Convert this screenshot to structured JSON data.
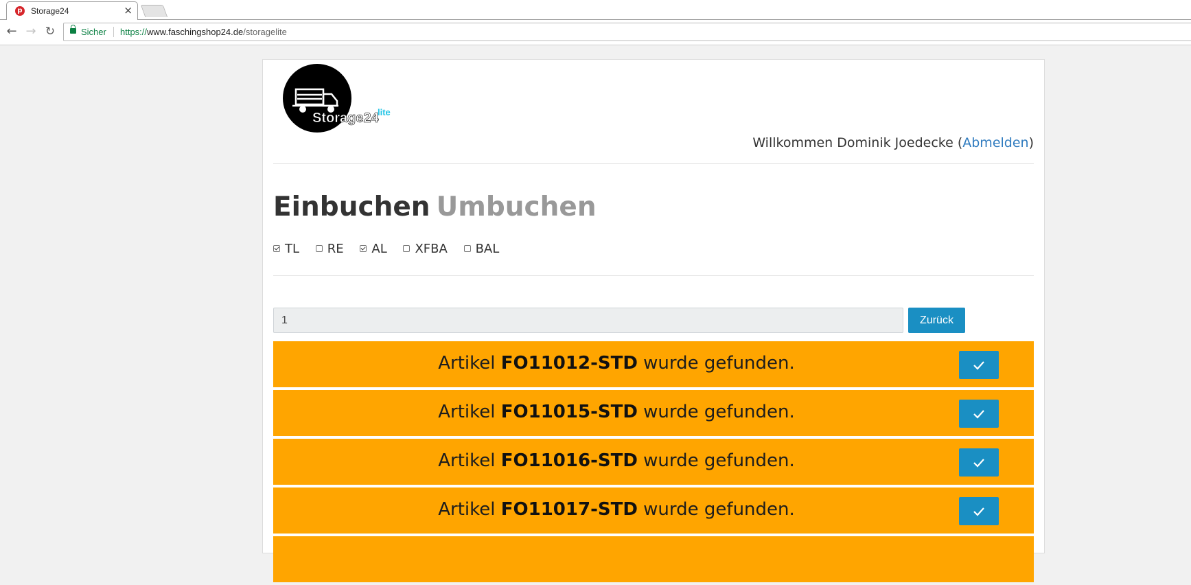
{
  "browser": {
    "tab_title": "Storage24",
    "tab_close": "×",
    "secure_label": "Sicher",
    "url_scheme": "https://",
    "url_host": "www.faschingshop24.de",
    "url_path": "/storagelite"
  },
  "header": {
    "logo_text": "Storage24",
    "logo_suffix": "lite",
    "welcome_prefix": "Willkommen Dominik Joedecke (",
    "logout_label": "Abmelden",
    "welcome_suffix": ")"
  },
  "modes": {
    "active": "Einbuchen",
    "inactive": "Umbuchen"
  },
  "filters": [
    {
      "label": "TL",
      "checked": true
    },
    {
      "label": "RE",
      "checked": false
    },
    {
      "label": "AL",
      "checked": true
    },
    {
      "label": "XFBA",
      "checked": false
    },
    {
      "label": "BAL",
      "checked": false
    }
  ],
  "search": {
    "value": "1",
    "button_label": "Zurück"
  },
  "results": [
    {
      "prefix": "Artikel ",
      "sku": "FO11012-STD",
      "suffix": " wurde gefunden."
    },
    {
      "prefix": "Artikel ",
      "sku": "FO11015-STD",
      "suffix": " wurde gefunden."
    },
    {
      "prefix": "Artikel ",
      "sku": "FO11016-STD",
      "suffix": " wurde gefunden."
    },
    {
      "prefix": "Artikel ",
      "sku": "FO11017-STD",
      "suffix": " wurde gefunden."
    }
  ],
  "colors": {
    "result_bg": "#ffa500",
    "button_blue": "#1a8fc3",
    "link_blue": "#2f7bbf",
    "logo_accent": "#22c4e6"
  },
  "icons": {
    "confirm": "checkmark-icon",
    "favicon": "faschingshop-favicon-icon"
  }
}
